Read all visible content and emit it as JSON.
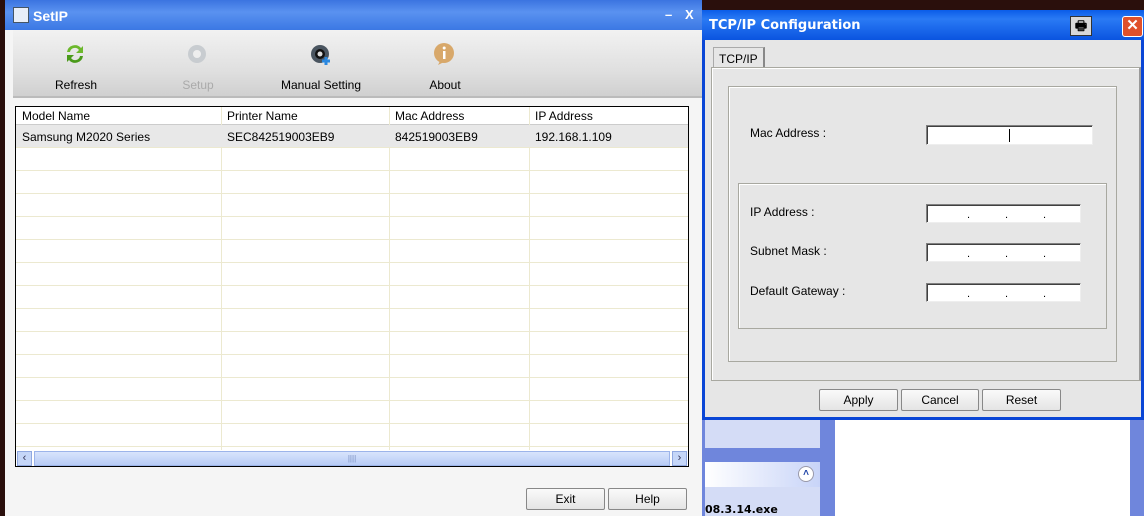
{
  "main_window": {
    "title": "SetIP",
    "controls": {
      "minimize": "–",
      "close": "X"
    },
    "toolbar": [
      {
        "label": "Refresh",
        "icon": "refresh-icon",
        "enabled": true
      },
      {
        "label": "Setup",
        "icon": "gear-icon",
        "enabled": false
      },
      {
        "label": "Manual Setting",
        "icon": "gear-add-icon",
        "enabled": true
      },
      {
        "label": "About",
        "icon": "info-icon",
        "enabled": true
      }
    ],
    "table": {
      "columns": [
        "Model Name",
        "Printer Name",
        "Mac Address",
        "IP Address"
      ],
      "rows": [
        [
          "Samsung M2020 Series",
          "SEC842519003EB9",
          "842519003EB9",
          "192.168.1.109"
        ]
      ]
    },
    "buttons": {
      "exit": "Exit",
      "help": "Help"
    }
  },
  "dialog": {
    "title": "TCP/IP Configuration",
    "tab": "TCP/IP",
    "mac_label": "Mac Address :",
    "mac_value": "",
    "ip_label": "IP Address :",
    "subnet_label": "Subnet Mask :",
    "gateway_label": "Default Gateway :",
    "ip_value": "",
    "buttons": {
      "apply": "Apply",
      "cancel": "Cancel",
      "reset": "Reset"
    }
  },
  "background": {
    "file_text": "08.3.14.exe"
  },
  "colors": {
    "title_blue": "#3b74e0",
    "xp_blue": "#0a54e0",
    "close_red": "#e0502a"
  }
}
